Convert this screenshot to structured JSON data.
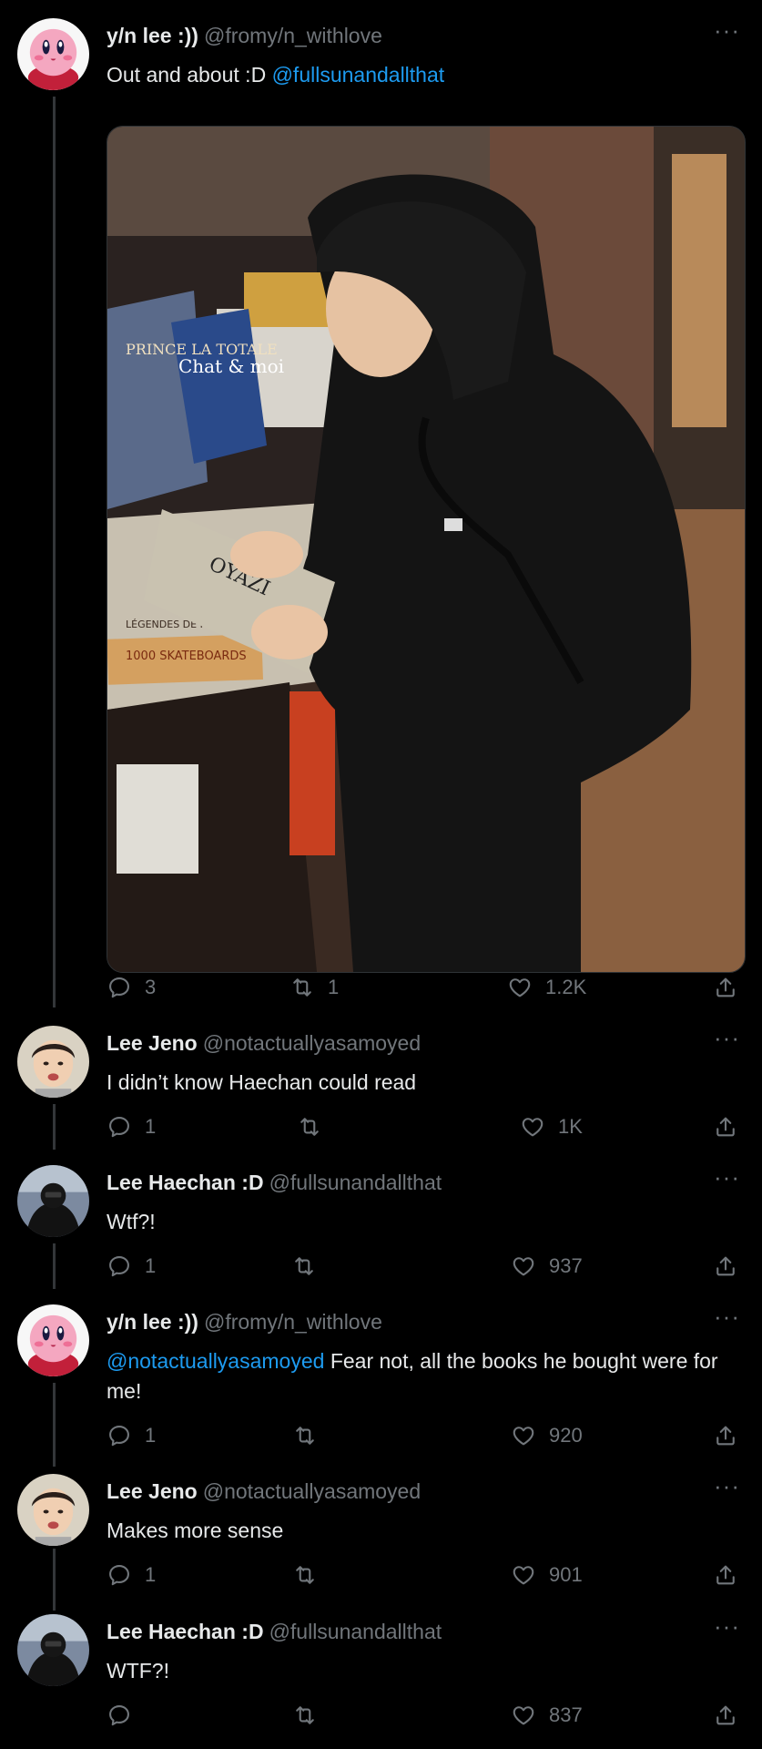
{
  "tweets": [
    {
      "name": "y/n lee :))",
      "handle": "@fromy/n_withlove",
      "more": "···",
      "mention": "@fullsunandallthat",
      "text": "Out and about :D",
      "replies": "3",
      "retweets": "1",
      "likes": "1.2K",
      "avatar": "kirby-avatar"
    },
    {
      "name": "Lee Jeno",
      "handle": "@notactuallyasamoyed",
      "more": "···",
      "text": "I didn’t know Haechan could read",
      "replies": "1",
      "retweets": "",
      "likes": "1K",
      "avatar": "jeno-avatar"
    },
    {
      "name": "Lee Haechan :D",
      "handle": "@fullsunandallthat",
      "more": "···",
      "text": "Wtf?!",
      "replies": "1",
      "retweets": "",
      "likes": "937",
      "avatar": "haechan-avatar"
    },
    {
      "name": "y/n lee :))",
      "handle": "@fromy/n_withlove",
      "more": "···",
      "mention": "@notactuallyasamoyed",
      "text": "Fear not, all the books he bought were for me!",
      "replies": "1",
      "retweets": "",
      "likes": "920",
      "avatar": "kirby-avatar"
    },
    {
      "name": "Lee Jeno",
      "handle": "@notactuallyasamoyed",
      "more": "···",
      "text": "Makes more sense",
      "replies": "1",
      "retweets": "",
      "likes": "901",
      "avatar": "jeno-avatar"
    },
    {
      "name": "Lee Haechan :D",
      "handle": "@fullsunandallthat",
      "more": "···",
      "text": "WTF?!",
      "replies": "",
      "retweets": "",
      "likes": "837",
      "avatar": "haechan-avatar"
    }
  ],
  "photo": {
    "description_icon": "bookstore-photo",
    "book_labels": [
      "PRINCE LA TOTALE",
      "Chat & moi",
      "1000 SKATEBOARDS",
      "LÉGENDES DE FRANCE"
    ]
  },
  "colors": {
    "background": "#000000",
    "text": "#e7e9ea",
    "muted": "#71767b",
    "accent": "#1d9bf0",
    "thread_line": "#333639"
  },
  "icons": [
    "reply-icon",
    "retweet-icon",
    "like-icon",
    "share-icon",
    "more-icon"
  ]
}
